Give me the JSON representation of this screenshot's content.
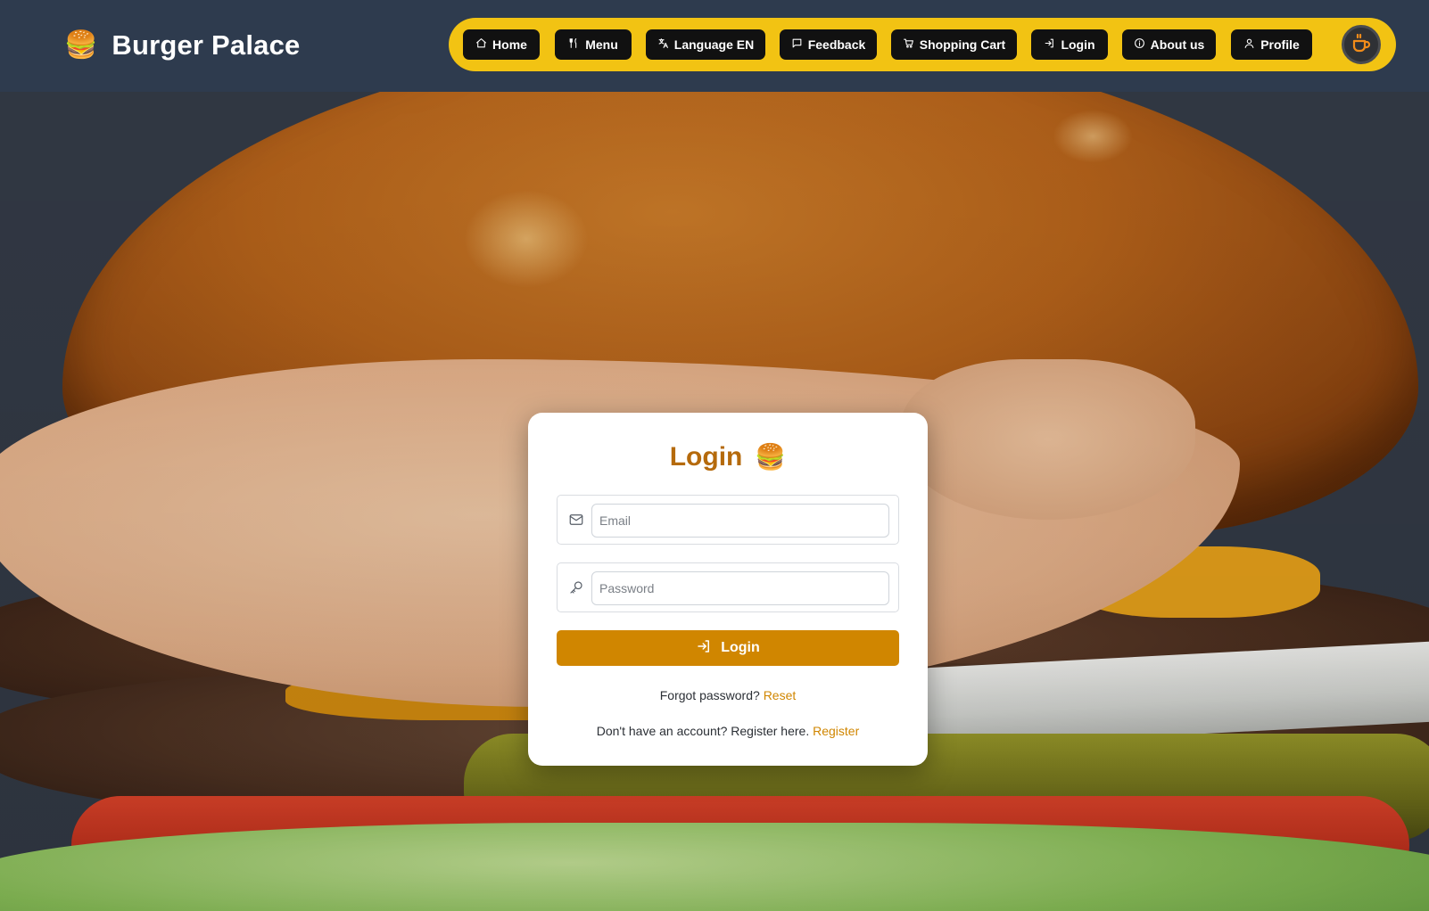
{
  "brand": {
    "icon": "🍔",
    "name": "Burger Palace"
  },
  "nav": {
    "items": [
      {
        "label": "Home",
        "icon": "home-icon"
      },
      {
        "label": "Menu",
        "icon": "utensils-icon"
      },
      {
        "label": "Language EN",
        "icon": "language-icon"
      },
      {
        "label": "Feedback",
        "icon": "message-icon"
      },
      {
        "label": "Shopping Cart",
        "icon": "cart-icon"
      },
      {
        "label": "Login",
        "icon": "login-icon"
      },
      {
        "label": "About us",
        "icon": "info-icon"
      },
      {
        "label": "Profile",
        "icon": "user-icon"
      }
    ],
    "theme_toggle_icon": "coffee-icon",
    "bar_color": "#f2c313"
  },
  "login": {
    "title": "Login",
    "title_icon": "🍔",
    "email_placeholder": "Email",
    "password_placeholder": "Password",
    "submit_label": "Login",
    "forgot_text": "Forgot password?",
    "forgot_link": "Reset",
    "register_text": "Don't have an account? Register here.",
    "register_link": "Register",
    "accent_color": "#d08600"
  }
}
